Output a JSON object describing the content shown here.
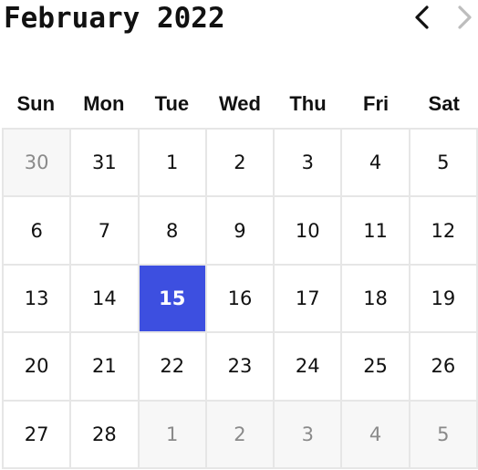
{
  "calendar": {
    "title": "February 2022",
    "prev_icon": "chevron-left-icon",
    "next_icon": "chevron-right-icon",
    "next_disabled": true,
    "weekdays": [
      "Sun",
      "Mon",
      "Tue",
      "Wed",
      "Thu",
      "Fri",
      "Sat"
    ],
    "weeks": [
      [
        {
          "label": "30",
          "outside": true
        },
        {
          "label": "31",
          "outside": false
        },
        {
          "label": "1",
          "outside": false
        },
        {
          "label": "2",
          "outside": false
        },
        {
          "label": "3",
          "outside": false
        },
        {
          "label": "4",
          "outside": false
        },
        {
          "label": "5",
          "outside": false
        }
      ],
      [
        {
          "label": "6",
          "outside": false
        },
        {
          "label": "7",
          "outside": false
        },
        {
          "label": "8",
          "outside": false
        },
        {
          "label": "9",
          "outside": false
        },
        {
          "label": "10",
          "outside": false
        },
        {
          "label": "11",
          "outside": false
        },
        {
          "label": "12",
          "outside": false
        }
      ],
      [
        {
          "label": "13",
          "outside": false
        },
        {
          "label": "14",
          "outside": false
        },
        {
          "label": "15",
          "outside": false,
          "selected": true
        },
        {
          "label": "16",
          "outside": false
        },
        {
          "label": "17",
          "outside": false
        },
        {
          "label": "18",
          "outside": false
        },
        {
          "label": "19",
          "outside": false
        }
      ],
      [
        {
          "label": "20",
          "outside": false
        },
        {
          "label": "21",
          "outside": false
        },
        {
          "label": "22",
          "outside": false
        },
        {
          "label": "23",
          "outside": false
        },
        {
          "label": "24",
          "outside": false
        },
        {
          "label": "25",
          "outside": false
        },
        {
          "label": "26",
          "outside": false
        }
      ],
      [
        {
          "label": "27",
          "outside": false
        },
        {
          "label": "28",
          "outside": false
        },
        {
          "label": "1",
          "outside": true
        },
        {
          "label": "2",
          "outside": true
        },
        {
          "label": "3",
          "outside": true
        },
        {
          "label": "4",
          "outside": true
        },
        {
          "label": "5",
          "outside": true
        }
      ]
    ]
  },
  "colors": {
    "selected_bg": "#3d4fe0",
    "selected_text": "#ffffff",
    "outside_bg": "#f7f7f7",
    "outside_text": "#8a8a8a",
    "grid_line": "#e6e6e6",
    "text": "#111111",
    "disabled_icon": "#bdbdbd"
  }
}
